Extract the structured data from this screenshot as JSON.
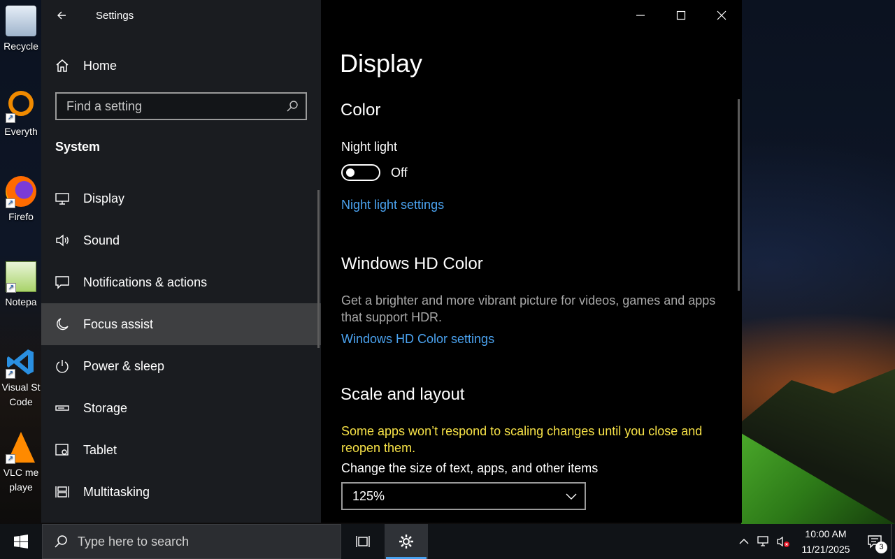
{
  "desktop": {
    "icons": [
      {
        "label": "Recycle",
        "icon": "recycle-bin-icon"
      },
      {
        "label": "Everyth",
        "icon": "everything-search-icon"
      },
      {
        "label": "Firefo",
        "icon": "firefox-icon"
      },
      {
        "label": "Notepa",
        "icon": "notepad-plus-plus-icon"
      },
      {
        "label": "Visual St\nCode",
        "icon": "vscode-icon"
      },
      {
        "label": "VLC me\nplaye",
        "icon": "vlc-icon"
      }
    ]
  },
  "window": {
    "title": "Settings",
    "nav": {
      "home_label": "Home",
      "search_placeholder": "Find a setting",
      "section": "System",
      "items": [
        {
          "label": "Display",
          "icon": "monitor-icon"
        },
        {
          "label": "Sound",
          "icon": "speaker-icon"
        },
        {
          "label": "Notifications & actions",
          "icon": "notification-icon"
        },
        {
          "label": "Focus assist",
          "icon": "moon-icon",
          "selected": true
        },
        {
          "label": "Power & sleep",
          "icon": "power-icon"
        },
        {
          "label": "Storage",
          "icon": "storage-icon"
        },
        {
          "label": "Tablet",
          "icon": "tablet-icon"
        },
        {
          "label": "Multitasking",
          "icon": "multitasking-icon"
        }
      ]
    },
    "content": {
      "page_title": "Display",
      "color": {
        "heading": "Color",
        "night_light_label": "Night light",
        "night_light_state": "Off",
        "night_light_link": "Night light settings"
      },
      "hd_color": {
        "heading": "Windows HD Color",
        "description": "Get a brighter and more vibrant picture for videos, games and apps that support HDR.",
        "link": "Windows HD Color settings"
      },
      "scale": {
        "heading": "Scale and layout",
        "warning": "Some apps won’t respond to scaling changes until you close and reopen them.",
        "size_label": "Change the size of text, apps, and other items",
        "size_value": "125%"
      }
    }
  },
  "taskbar": {
    "search_placeholder": "Type here to search",
    "time": "10:00 AM",
    "date": "11/21/2025",
    "notification_count": "3"
  },
  "colors": {
    "accent": "#4ba3f0",
    "warning": "#f7e247",
    "selected_bg": "#5a5a5a"
  }
}
